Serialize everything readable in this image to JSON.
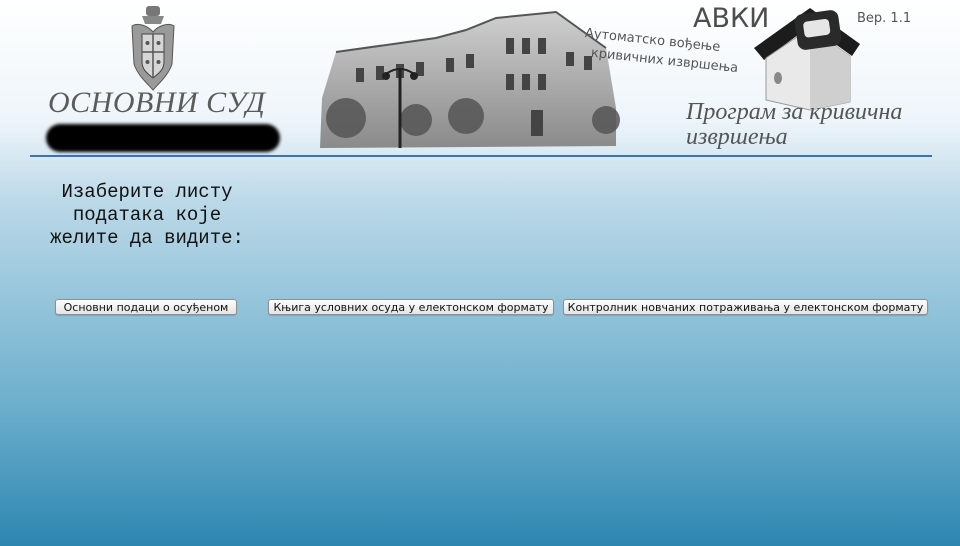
{
  "header": {
    "court_title": "ОСНОВНИ СУД",
    "tagline_line1": "Аутоматско вођење",
    "tagline_line2": "кривичних извршења",
    "app_abbr": "АВКИ",
    "version": "Вер. 1.1",
    "program_title": "Програм за кривична извршења"
  },
  "main": {
    "prompt": "Изаберите листу\nподатака које\nжелите да видите:",
    "buttons": [
      {
        "label": "Основни подаци о осуђеном"
      },
      {
        "label": "Књига условних осуда у електонском формату"
      },
      {
        "label": "Контролник новчаних потраживања у електонском формату"
      }
    ]
  },
  "colors": {
    "divider": "#3c73b6",
    "background_top": "#ffffff",
    "background_bottom": "#2d86b0"
  },
  "icons": [
    "serbian-coat-of-arms-icon",
    "courthouse-building-image",
    "house-logo-icon"
  ]
}
